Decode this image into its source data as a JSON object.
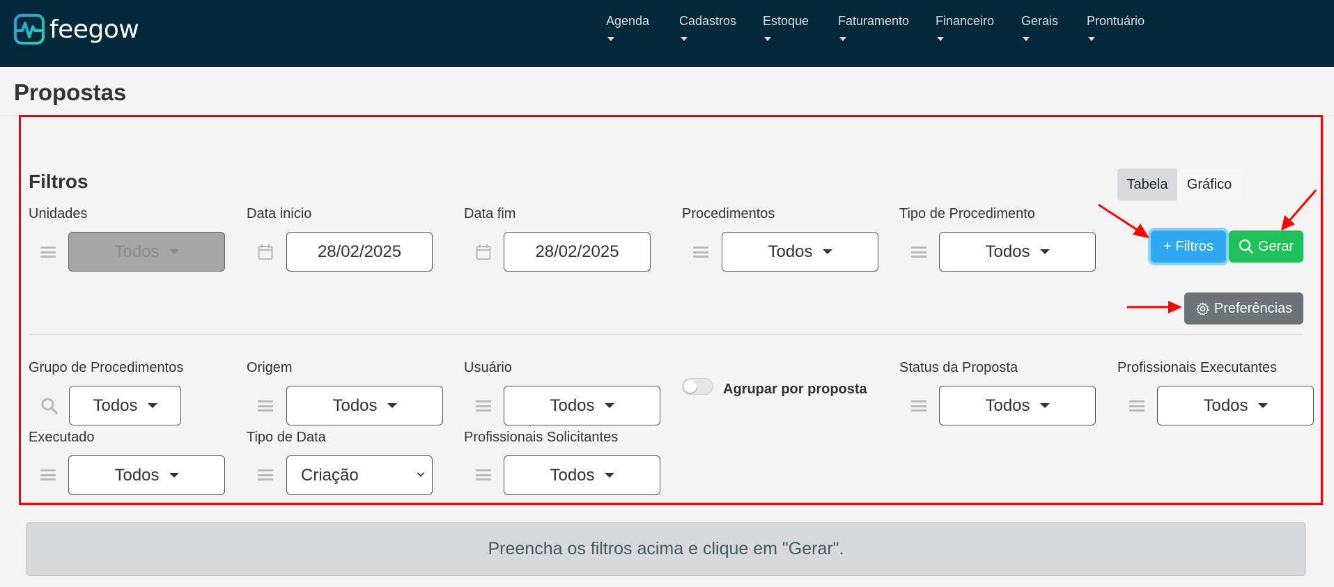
{
  "app": {
    "brand": "feegow"
  },
  "nav": [
    {
      "label": "Agenda"
    },
    {
      "label": "Cadastros"
    },
    {
      "label": "Estoque"
    },
    {
      "label": "Faturamento"
    },
    {
      "label": "Financeiro"
    },
    {
      "label": "Gerais"
    },
    {
      "label": "Prontuário"
    }
  ],
  "page": {
    "title": "Propostas"
  },
  "filters": {
    "title": "Filtros",
    "view_toggle": {
      "table": "Tabela",
      "chart": "Gráfico"
    },
    "unidades": {
      "label": "Unidades",
      "value": "Todos",
      "disabled": true
    },
    "data_inicio": {
      "label": "Data inicio",
      "value": "28/02/2025"
    },
    "data_fim": {
      "label": "Data fim",
      "value": "28/02/2025"
    },
    "procedimentos": {
      "label": "Procedimentos",
      "value": "Todos"
    },
    "tipo_procedimento": {
      "label": "Tipo de Procedimento",
      "value": "Todos"
    },
    "grupo_procedimentos": {
      "label": "Grupo de Procedimentos",
      "value": "Todos"
    },
    "origem": {
      "label": "Origem",
      "value": "Todos"
    },
    "usuario": {
      "label": "Usuário",
      "value": "Todos"
    },
    "agrupar": {
      "label": "Agrupar por proposta",
      "checked": false
    },
    "status_proposta": {
      "label": "Status da Proposta",
      "value": "Todos"
    },
    "profissionais_executantes": {
      "label": "Profissionais Executantes",
      "value": "Todos"
    },
    "executado": {
      "label": "Executado",
      "value": "Todos"
    },
    "tipo_data": {
      "label": "Tipo de Data",
      "value": "Criação"
    },
    "profissionais_solicitantes": {
      "label": "Profissionais Solicitantes",
      "value": "Todos"
    }
  },
  "buttons": {
    "filtros": "+ Filtros",
    "gerar": "Gerar",
    "preferencias": "Preferências"
  },
  "info": {
    "message": "Preencha os filtros acima e clique em \"Gerar\"."
  },
  "colors": {
    "topbar": "#04293a",
    "filtros_btn": "#2ea8f0",
    "gerar_btn": "#1fc25a",
    "pref_btn": "#6c7278",
    "highlight": "#ff0000"
  }
}
